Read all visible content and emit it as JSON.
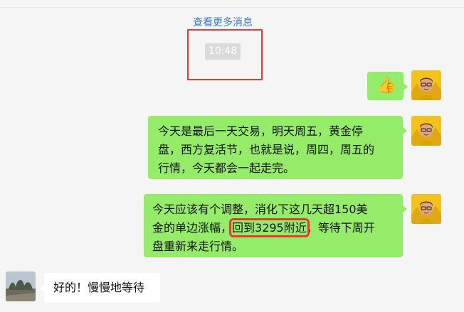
{
  "chat": {
    "more_messages_label": "查看更多消息",
    "timestamp": "10:48",
    "messages": [
      {
        "sender": "me",
        "type": "emoji",
        "emoji": "👍",
        "emoji_name": "thumbs-up"
      },
      {
        "sender": "me",
        "type": "text",
        "lines": [
          "今天是最后一天交易，明天周五，黄金停",
          "盘，西方复活节，也就是说，周四，周五的",
          "行情，今天都会一起走完。"
        ]
      },
      {
        "sender": "me",
        "type": "text",
        "line1": "今天应该有个调整，消化下这几天超150美",
        "line2_before": "金的单边涨幅，",
        "line2_highlight": "回到3295附近",
        "line2_after": "，等待下周开",
        "line3": "盘重新来走行情。"
      },
      {
        "sender": "other",
        "type": "text",
        "text": "好的！慢慢地等待"
      }
    ]
  },
  "colors": {
    "my_bubble": "#95ec69",
    "other_bubble": "#ffffff",
    "highlight_box": "#e53b32",
    "link": "#3b7bd4",
    "background": "#f5f5f5"
  },
  "icons": {
    "my_avatar": "cartoon-avatar-yellow",
    "other_avatar": "landscape-avatar"
  }
}
